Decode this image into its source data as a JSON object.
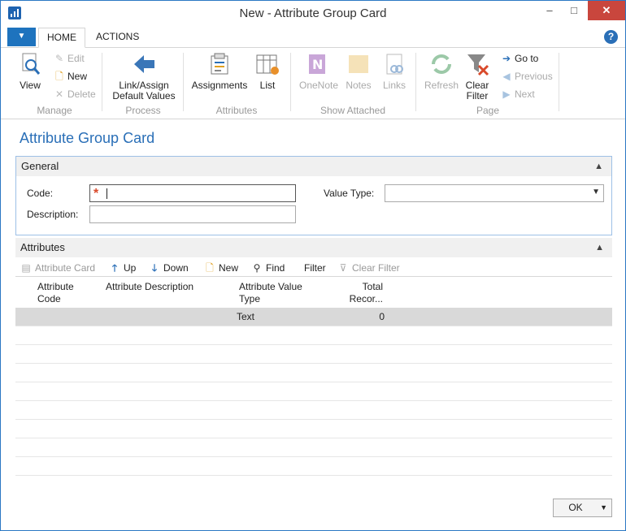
{
  "window": {
    "title": "New - Attribute Group Card",
    "min": "–",
    "max": "□",
    "close": "✕"
  },
  "tabs": {
    "home": "HOME",
    "actions": "ACTIONS",
    "help": "?"
  },
  "ribbon": {
    "manage": {
      "label": "Manage",
      "view": "View",
      "edit": "Edit",
      "new": "New",
      "delete": "Delete"
    },
    "process": {
      "label": "Process",
      "link_assign_1": "Link/Assign",
      "link_assign_2": "Default Values"
    },
    "attributes": {
      "label": "Attributes",
      "assignments": "Assignments",
      "list": "List"
    },
    "show_attached": {
      "label": "Show Attached",
      "onenote": "OneNote",
      "notes": "Notes",
      "links": "Links"
    },
    "page": {
      "label": "Page",
      "refresh": "Refresh",
      "clear_filter_1": "Clear",
      "clear_filter_2": "Filter",
      "go_to": "Go to",
      "previous": "Previous",
      "next": "Next"
    }
  },
  "page_title": "Attribute Group Card",
  "general": {
    "header": "General",
    "code_label": "Code:",
    "code_value": "",
    "description_label": "Description:",
    "description_value": "",
    "value_type_label": "Value Type:",
    "value_type_value": ""
  },
  "attributes": {
    "header": "Attributes",
    "toolbar": {
      "attribute_card": "Attribute Card",
      "up": "Up",
      "down": "Down",
      "new": "New",
      "find": "Find",
      "filter": "Filter",
      "clear_filter": "Clear Filter"
    },
    "columns": {
      "code_1": "Attribute",
      "code_2": "Code",
      "description": "Attribute Description",
      "type_1": "Attribute Value",
      "type_2": "Type",
      "total_1": "Total",
      "total_2": "Recor..."
    },
    "rows": [
      {
        "code": "",
        "description": "",
        "type": "Text",
        "total": "0"
      }
    ]
  },
  "ok_button": "OK",
  "colors": {
    "accent": "#2a6fb7",
    "required": "#d94a2b",
    "close": "#c9463d"
  }
}
